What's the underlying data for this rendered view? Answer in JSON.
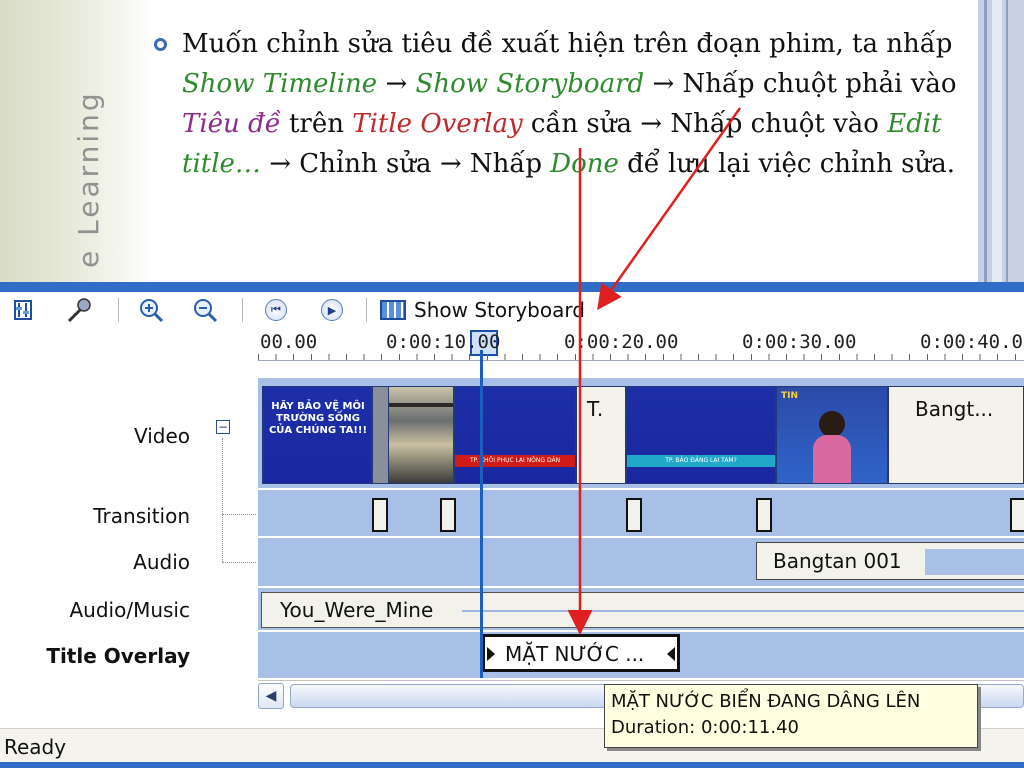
{
  "slide": {
    "watermark": "e Learning",
    "text": {
      "p1": "Muốn chỉnh sửa tiêu đề xuất hiện trên đoạn phim, ta nhấp",
      "show_timeline": "Show Timeline",
      "arrow": "→",
      "show_storyboard": "Show Storyboard",
      "p2": "Nhấp chuột phải vào",
      "tieu_de": "Tiêu đề",
      "p3": "trên",
      "title_overlay": "Title Overlay",
      "p4": "cần sửa",
      "p5": "Nhấp chuột vào",
      "edit_title": "Edit title…",
      "p6": "Chỉnh sửa",
      "p7": "Nhấp",
      "done": "Done",
      "p8": "để lưu lại việc chỉnh sửa."
    }
  },
  "toolbar": {
    "show_storyboard": "Show Storyboard"
  },
  "ruler": {
    "ticks": [
      "00.00",
      "0:00:10.00",
      "0:00:20.00",
      "0:00:30.00",
      "0:00:40.00"
    ]
  },
  "tracks": {
    "video": "Video",
    "transition": "Transition",
    "audio": "Audio",
    "music": "Audio/Music",
    "title_overlay": "Title Overlay"
  },
  "clips": {
    "video1_text": "HÃY BẢO VỆ MÔI TRƯỜNG SỐNG CỦA CHÚNG TA!!!",
    "video3_strip": "TP. KHÔI PHỤC LẠI NÔNG DÂN",
    "video4_label": "T.",
    "video5_strip": "TP. BẢO ĐẢNG LẠI TAM?",
    "video6_badge": "TIN",
    "video7_label": "Bangt...",
    "audio": "Bangtan 001",
    "music": "You_Were_Mine",
    "title": "MẶT NƯỚC ..."
  },
  "tooltip": {
    "line1": "MẶT NƯỚC BIỂN ĐANG DÂNG LÊN",
    "line2": "Duration:  0:00:11.40"
  },
  "status": {
    "text": "Ready"
  },
  "colors": {
    "accent": "#2f6dc6",
    "track": "#a8bfe6",
    "annotation": "#e02020",
    "green_text": "#2d8a2d",
    "purple_text": "#8e2b8e",
    "red_text": "#c0282a"
  }
}
